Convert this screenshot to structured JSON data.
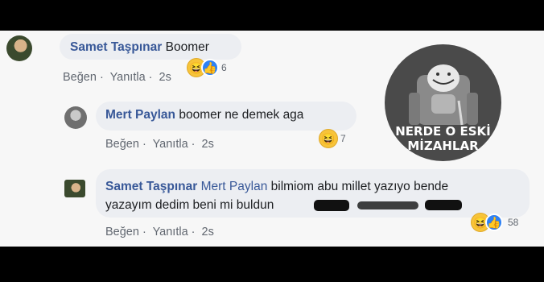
{
  "comments": [
    {
      "author": "Samet Taşpınar",
      "text": "Boomer",
      "like": "Beğen",
      "reply": "Yanıtla",
      "time": "2s",
      "reactions": [
        "haha-icon",
        "like-icon"
      ],
      "reaction_count": "6"
    },
    {
      "author": "Mert Paylan",
      "text": "boomer ne demek aga",
      "like": "Beğen",
      "reply": "Yanıtla",
      "time": "2s",
      "reactions": [
        "haha-icon"
      ],
      "reaction_count": "7"
    },
    {
      "author": "Samet Taşpınar",
      "mention": "Mert Paylan",
      "text_line1": "bilmiom abu millet yazıyo bende",
      "text_line2": "yazayım dedim beni mi buldun",
      "like": "Beğen",
      "reply": "Yanıtla",
      "time": "2s",
      "reactions": [
        "haha-icon",
        "like-icon"
      ],
      "reaction_count": "58"
    }
  ],
  "badge": {
    "line1": "NERDE O ESKİ",
    "line2": "MİZAHLAR"
  },
  "colors": {
    "name": "#385898",
    "bubble": "#eceef2",
    "meta": "#616770",
    "haha": "#f7c43a",
    "like": "#2e81f4"
  }
}
